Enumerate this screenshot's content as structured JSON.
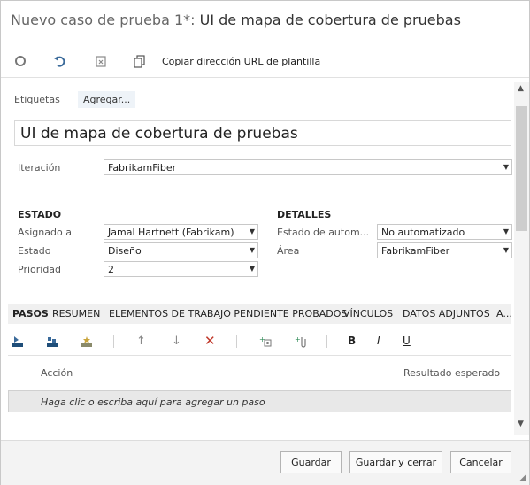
{
  "dialog": {
    "title_prefix": "Nuevo caso de prueba 1*:",
    "title_name": "UI de mapa de cobertura de pruebas"
  },
  "toolbar": {
    "icons": [
      "refresh-icon",
      "undo-icon",
      "revert-icon",
      "copy-icon"
    ],
    "copy_url_label": "Copiar dirección URL de plantilla"
  },
  "tags": {
    "label": "Etiquetas",
    "add_label": "Agregar..."
  },
  "work_item": {
    "title": "UI de mapa de cobertura de pruebas",
    "iteration_label": "Iteración",
    "iteration_value": "FabrikamFiber"
  },
  "estado_section": {
    "heading": "ESTADO",
    "assigned_label": "Asignado a",
    "assigned_value": "Jamal Hartnett (Fabrikam)",
    "state_label": "Estado",
    "state_value": "Diseño",
    "priority_label": "Prioridad",
    "priority_value": "2"
  },
  "detalles_section": {
    "heading": "DETALLES",
    "automation_label": "Estado de autom...",
    "automation_value": "No automatizado",
    "area_label": "Área",
    "area_value": "FabrikamFiber"
  },
  "tabs": [
    "PASOS",
    "RESUMEN",
    "ELEMENTOS DE TRABAJO PENDIENTE PROBADOS",
    "VÍNCULOS",
    "DATOS ADJUNTOS",
    "A..."
  ],
  "steps": {
    "action_header": "Acción",
    "expected_header": "Resultado esperado",
    "add_placeholder": "Haga clic o escriba aquí para agregar un paso",
    "format_bold": "B",
    "format_italic": "I",
    "format_underline": "U"
  },
  "footer": {
    "save": "Guardar",
    "save_close": "Guardar y cerrar",
    "cancel": "Cancelar"
  },
  "colors": {
    "accent": "#3a6a9a",
    "delete": "#c0392b",
    "tab_bg": "#f0f0f0"
  }
}
